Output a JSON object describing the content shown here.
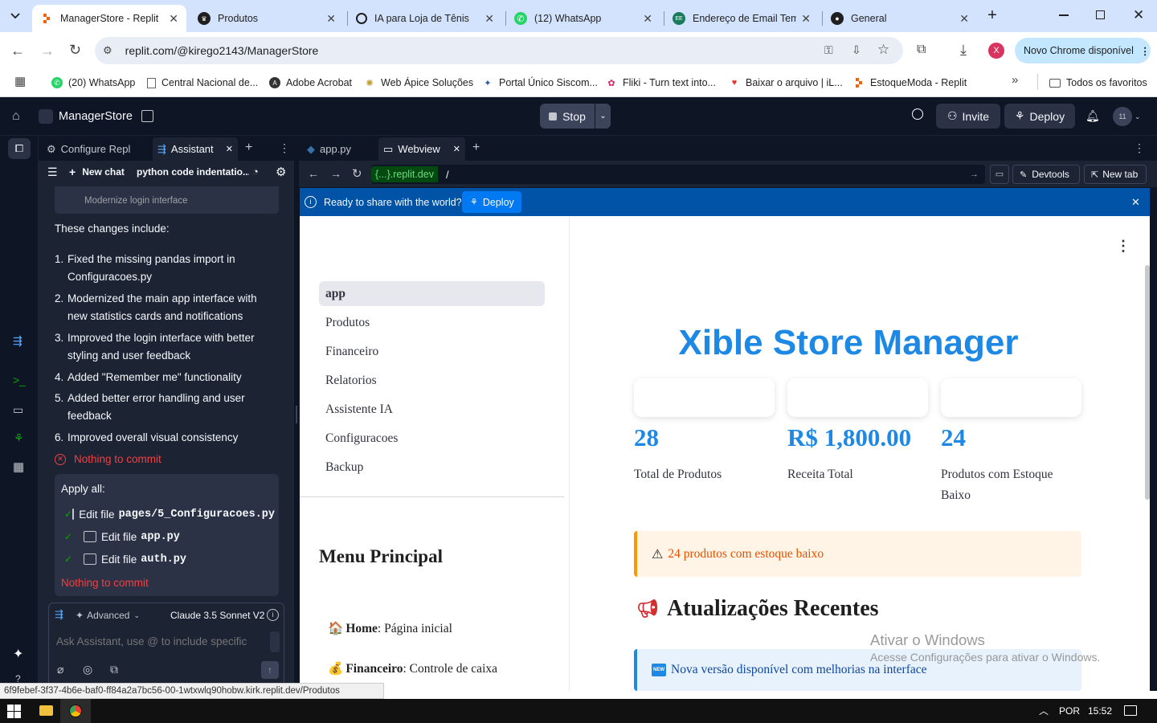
{
  "browser": {
    "tabs": [
      {
        "title": "ManagerStore - Replit",
        "icon": "replit-icon",
        "active": true
      },
      {
        "title": "Produtos",
        "icon": "streamlit-icon"
      },
      {
        "title": "IA para Loja de Tênis",
        "icon": "openai-icon"
      },
      {
        "title": "(12) WhatsApp",
        "icon": "whatsapp-icon"
      },
      {
        "title": "Endereço de Email Temp",
        "icon": "email-icon"
      },
      {
        "title": "General",
        "icon": "github-icon"
      }
    ],
    "url": "replit.com/@kirego2143/ManagerStore",
    "update_button": "Novo Chrome disponível",
    "profile_initial": "X",
    "bookmarks": [
      {
        "label": "(20) WhatsApp",
        "icon": "whatsapp-icon"
      },
      {
        "label": "Central Nacional de...",
        "icon": "document-icon"
      },
      {
        "label": "Adobe Acrobat",
        "icon": "acrobat-icon"
      },
      {
        "label": "Web Ápice Soluções",
        "icon": "web-icon"
      },
      {
        "label": "Portal Único Siscom...",
        "icon": "portal-icon"
      },
      {
        "label": "Fliki - Turn text into...",
        "icon": "fliki-icon"
      },
      {
        "label": "Baixar o arquivo | iL...",
        "icon": "heart-icon"
      },
      {
        "label": "EstoqueModa - Replit",
        "icon": "replit-icon"
      }
    ],
    "all_bookmarks": "Todos os favoritos"
  },
  "replit": {
    "project_name": "ManagerStore",
    "stop_label": "Stop",
    "invite_label": "Invite",
    "deploy_label": "Deploy",
    "avatar_badge": "11",
    "left_tabs": {
      "configure": "Configure Repl",
      "assistant": "Assistant"
    },
    "chat_header": {
      "new_chat": "New chat",
      "chat_title": "python code indentatio..."
    },
    "faded_item": "Modernize login interface",
    "intro": "These changes include:",
    "changes": [
      {
        "n": "1.",
        "text": "Fixed the missing pandas import in Configuracoes.py"
      },
      {
        "n": "2.",
        "text": "Modernized the main app interface with new statistics cards and notifications"
      },
      {
        "n": "3.",
        "text": "Improved the login interface with better styling and user feedback"
      },
      {
        "n": "4.",
        "text": "Added \"Remember me\" functionality"
      },
      {
        "n": "5.",
        "text": "Added better error handling and user feedback"
      },
      {
        "n": "6.",
        "text": "Improved overall visual consistency"
      }
    ],
    "nothing_commit_1": "Nothing to commit",
    "apply_all": "Apply all:",
    "edits": [
      {
        "prefix": "Edit file",
        "file": "pages/5_Configuracoes.py"
      },
      {
        "prefix": "Edit file",
        "file": "app.py"
      },
      {
        "prefix": "Edit file",
        "file": "auth.py"
      }
    ],
    "nothing_commit_2": "Nothing to commit",
    "advanced": "Advanced",
    "model": "Claude 3.5 Sonnet V2",
    "input_placeholder": "Ask Assistant, use @ to include specific",
    "right_tabs": {
      "file": "app.py",
      "webview": "Webview"
    },
    "webview_url_domain": "{...}.replit.dev",
    "webview_url_path": "/",
    "devtools": "Devtools",
    "new_tab": "New tab",
    "banner_text": "Ready to share with the world?",
    "banner_deploy": "Deploy"
  },
  "app": {
    "nav": [
      "app",
      "Produtos",
      "Financeiro",
      "Relatorios",
      "Assistente IA",
      "Configuracoes",
      "Backup"
    ],
    "menu_title": "Menu Principal",
    "menu_items": [
      {
        "icon": "🏠",
        "bold": "Home",
        "rest": ": Página inicial"
      },
      {
        "icon": "💰",
        "bold": "Financeiro",
        "rest": ": Controle de caixa"
      }
    ],
    "title": "Xible Store Manager",
    "metrics": [
      {
        "value": "28",
        "label": "Total de Produtos"
      },
      {
        "value": "R$ 1,800.00",
        "label": "Receita Total"
      },
      {
        "value": "24",
        "label": "Produtos com Estoque Baixo"
      }
    ],
    "warning": "24 produtos com estoque baixo",
    "updates_title": "Atualizações Recentes",
    "update_item": "Nova versão disponível com melhorias na interface",
    "accent": "#1e88e5"
  },
  "watermark": {
    "title": "Ativar o Windows",
    "subtitle": "Acesse Configurações para ativar o Windows."
  },
  "status_url": "6f9febef-3f37-4b6e-baf0-ff84a2a7bc56-00-1wtxwlq90hobw.kirk.replit.dev/Produtos",
  "taskbar": {
    "lang": "POR",
    "time": "15:52"
  }
}
